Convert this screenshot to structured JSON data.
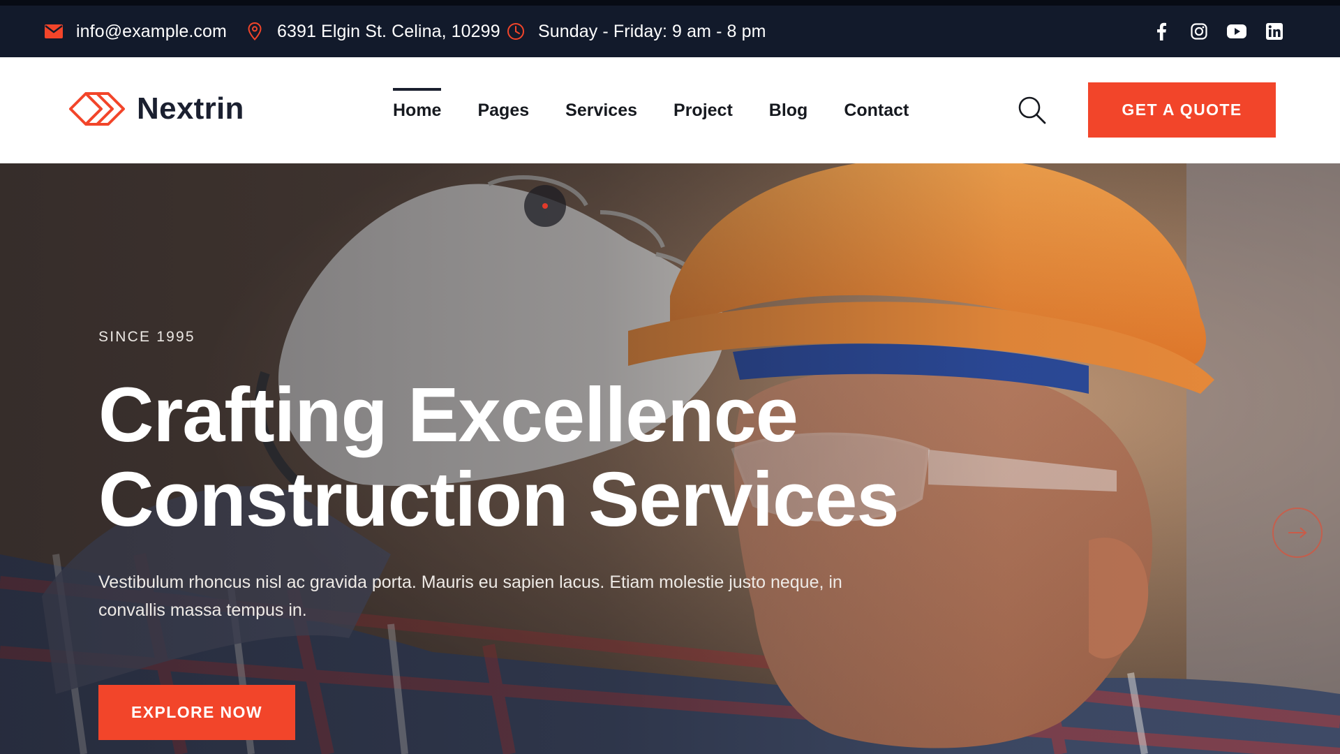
{
  "topbar": {
    "email": "info@example.com",
    "address": "6391 Elgin St. Celina, 10299",
    "hours": "Sunday - Friday: 9 am - 8 pm",
    "socials": [
      "facebook-icon",
      "instagram-icon",
      "youtube-icon",
      "linkedin-icon"
    ]
  },
  "header": {
    "logo_text": "Nextrin",
    "nav": [
      {
        "label": "Home",
        "active": true
      },
      {
        "label": "Pages",
        "active": false
      },
      {
        "label": "Services",
        "active": false
      },
      {
        "label": "Project",
        "active": false
      },
      {
        "label": "Blog",
        "active": false
      },
      {
        "label": "Contact",
        "active": false
      }
    ],
    "quote_button": "GET A QUOTE"
  },
  "hero": {
    "eyebrow": "SINCE 1995",
    "headline_line1": "Crafting Excellence",
    "headline_line2": "Construction Services",
    "lead": "Vestibulum rhoncus nisl ac gravida porta. Mauris eu sapien lacus. Etiam molestie justo neque, in convallis massa tempus in.",
    "cta": "EXPLORE NOW"
  },
  "colors": {
    "accent": "#f2452a",
    "topbar_bg": "#121a2b",
    "nav_text": "#16191f"
  }
}
